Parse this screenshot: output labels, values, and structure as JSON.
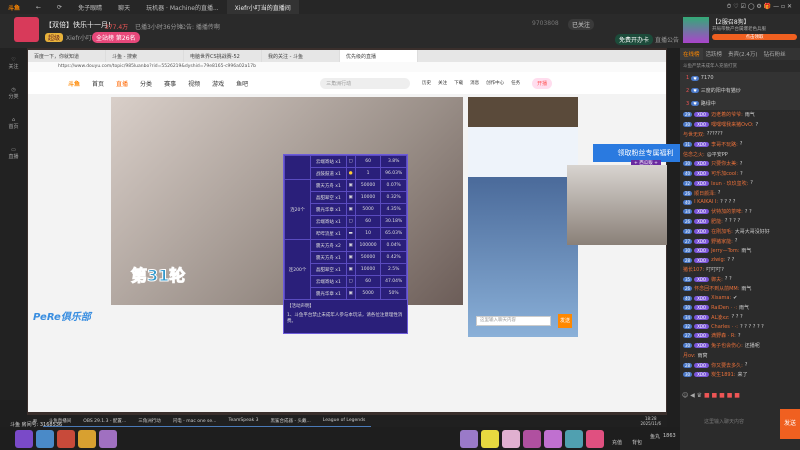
{
  "topbar": {
    "logo": "斗鱼",
    "tabs": [
      "免子眼睛",
      "聊天",
      "玩机器 · Machine的直播...",
      "Xiefr小叮当的直播间"
    ]
  },
  "header": {
    "title": "【双倍】快乐十一月!",
    "heat": "377.4万",
    "duration": "已播3小时36分钟",
    "notice": "公告: 播播传啊",
    "streamer": "Xiefr小叮当",
    "level": "超级",
    "rank": "全站榜 第26名",
    "room_id": "9703808",
    "follow": "已关注",
    "free_card": "免费开办卡",
    "announce": "直播公告"
  },
  "ad": {
    "title": "【2服召8狗】",
    "desc": "开局带数产台属爆老色兵服",
    "button": "点击领取",
    "tag": "广告"
  },
  "sidebar": [
    "关注",
    "分类",
    "首页",
    "直播"
  ],
  "browser": {
    "tabs": [
      "百度一下，你就知道",
      "斗鱼 - 搜索",
      "电脑世界CS挑战赛-52",
      "我的关注 - 斗鱼",
      "优先级的直播"
    ],
    "url": "https://www.douyu.com/topic/985luanbo?rid=5526219&dyshid=79e8165-c996a02a17b",
    "nav": [
      "首页",
      "直播",
      "分类",
      "赛事",
      "视频",
      "游戏",
      "鱼吧"
    ],
    "search_placeholder": "三角洲行动",
    "icons": [
      "历史",
      "关注",
      "下载",
      "消息",
      "创作中心",
      "任务"
    ],
    "live_button": "开播",
    "round": "第31轮",
    "club": "PeRe俱乐部",
    "fan_banner": "领取粉丝专属福利",
    "fan_sub": "+ 西瓜贩 +",
    "chat_placeholder": "这里输入聊天内容",
    "send": "发送"
  },
  "gift_table": {
    "top_rows": [
      [
        "云端寄站 x1",
        "60",
        "3.8%"
      ],
      [
        "战鼓鼓道 x1",
        "1",
        "96.03%"
      ]
    ],
    "groups": [
      {
        "label": "连20个",
        "rows": [
          [
            "震天方舟 x1",
            "50000",
            "0.07%"
          ],
          [
            "晶甜翠空 x1",
            "10000",
            "0.32%"
          ],
          [
            "震光华章 x1",
            "5000",
            "4.35%"
          ],
          [
            "云端寄站 x1",
            "60",
            "30.18%"
          ],
          [
            "哔哔流星 x1",
            "10",
            "65.03%"
          ]
        ]
      },
      {
        "label": "连200个",
        "rows": [
          [
            "震天方舟 x2",
            "100000",
            "0.04%"
          ],
          [
            "震天方舟 x1",
            "50000",
            "0.42%"
          ],
          [
            "晶甜翠空 x1",
            "10000",
            "2.5%"
          ],
          [
            "云端寄站 x1",
            "60",
            "47.04%"
          ],
          [
            "震光华章 x1",
            "5000",
            "50%"
          ]
        ]
      }
    ],
    "note_title": "【活动声明】",
    "note": "1、斗鱼平台禁止未成年人参与本玩法，请各位注意理性消费。"
  },
  "right": {
    "tabs": [
      "在线榜",
      "活跃榜",
      "贵宾(2.4万)",
      "钻石粉丝"
    ],
    "notice": "斗鱼严禁未成年人充值打赏",
    "top3": [
      [
        "1",
        "7170"
      ],
      [
        "2",
        "三度的阳中有猫炒"
      ],
      [
        "3",
        "路绿中"
      ]
    ],
    "chat": [
      [
        "29",
        "XDO",
        "迈老着的爷爷:",
        "雨气"
      ],
      [
        "30",
        "XDO",
        "嘿嘿嘿我来猪OvO:",
        "?"
      ],
      [
        "",
        "",
        "与世无双:",
        "??????"
      ],
      [
        "31",
        "XDO",
        "李哥不玩路:",
        "?"
      ],
      [
        "",
        "",
        "信念之火:",
        "@平安PP"
      ],
      [
        "30",
        "XDO",
        "只要你太美:",
        "?"
      ],
      [
        "40",
        "XDO",
        "可乐加cool:",
        "?"
      ],
      [
        "32",
        "XDO",
        "Ixun · 玖玖玺吹:",
        "?"
      ],
      [
        "26",
        "",
        "顺日颜泽:",
        "?"
      ],
      [
        "40",
        "",
        "I KAIKAI I:",
        "? ? ? ?"
      ],
      [
        "34",
        "XDO",
        "伏特加的茶啤:",
        "? ?"
      ],
      [
        "26",
        "XDO",
        "肥能:",
        "? ? ? ?"
      ],
      [
        "30",
        "XDO",
        "在刚加毛:",
        "大哥大哥没好好"
      ],
      [
        "27",
        "XDO",
        "野猪家能:",
        "?"
      ],
      [
        "30",
        "XDO",
        "Jerry—Tom:",
        "雨气"
      ],
      [
        "28",
        "XDO",
        "zlwig:",
        "? ?"
      ],
      [
        "",
        "",
        "猪长107:",
        "叮叮叮?"
      ],
      [
        "35",
        "XDO",
        "御夫:",
        "? ?"
      ],
      [
        "26",
        "",
        "怀念回不到从前MM:",
        "雨气"
      ],
      [
        "40",
        "XDO",
        "Xisama:",
        "✔"
      ],
      [
        "30",
        "XDO",
        "RaiDen · ·:",
        "雨气"
      ],
      [
        "34",
        "XDO",
        "AL凌xz:",
        "? ? ?"
      ],
      [
        "32",
        "XDO",
        "Charles · ·:",
        "? ? ? ? ? ?"
      ],
      [
        "27",
        "XDO",
        "滴野森 · R:",
        "?"
      ],
      [
        "30",
        "XDO",
        "兔子也会伤心:",
        "还播呢"
      ],
      [
        "",
        "",
        "月ov:",
        "雨窝"
      ],
      [
        "28",
        "XDO",
        "你又要去多久:",
        "?"
      ],
      [
        "30",
        "XDO",
        "炭生1891:",
        "来了"
      ]
    ],
    "input_placeholder": "这里输入聊天内容",
    "send": "发送"
  },
  "taskbar": {
    "items": [
      "斗鱼直播间",
      "OBS 29.1.3 - 配置...",
      "三角洲行动",
      "闪电 - mac one se...",
      "TeamSpeak 3",
      "黑鲨合成器 - 头戴...",
      "League of Legends"
    ],
    "time": "18:28",
    "date": "2025/11/6"
  },
  "bottom": {
    "room": "斗鱼 房间号: 3168536",
    "recharge": "充值",
    "bag": "背包",
    "fishball_label": "鱼丸",
    "fishball": "1863"
  }
}
